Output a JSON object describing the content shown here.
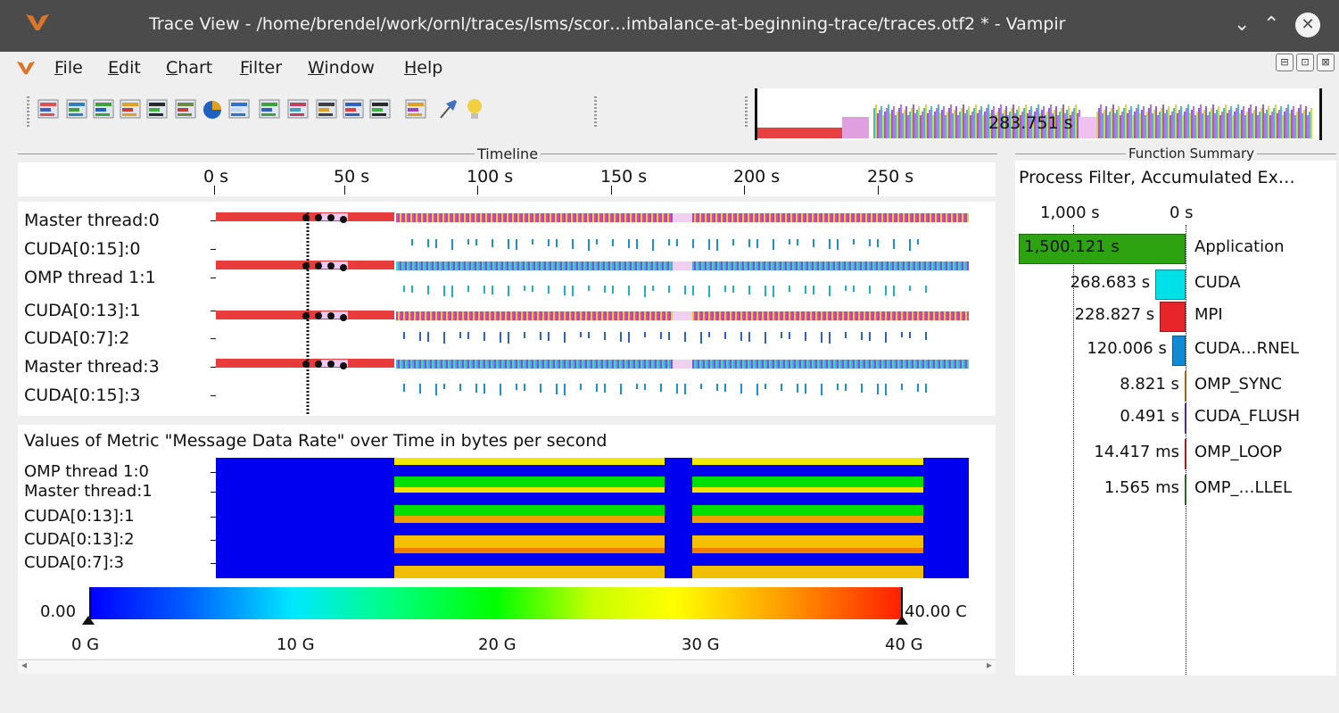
{
  "window": {
    "title": "Trace View - /home/brendel/work/ornl/traces/lsms/scor…imbalance-at-beginning-trace/traces.otf2 * - Vampir",
    "controls": {
      "minimize": "⌄",
      "maximize": "⌃",
      "close": "✕"
    }
  },
  "menu": {
    "items": [
      {
        "label": "File",
        "accel": "F"
      },
      {
        "label": "Edit",
        "accel": "E"
      },
      {
        "label": "Chart",
        "accel": "C"
      },
      {
        "label": "Filter",
        "accel": "F"
      },
      {
        "label": "Window",
        "accel": "W"
      },
      {
        "label": "Help",
        "accel": "H"
      }
    ],
    "mdi_buttons": [
      "⊟",
      "⊡",
      "⊠"
    ]
  },
  "toolbar": {
    "icons": [
      "master-timeline-icon",
      "process-timeline-icon",
      "counter-timeline-icon",
      "performance-radar-icon",
      "summary-timeline-icon",
      "function-summary-icon",
      "pie-chart-icon",
      "context-view-icon",
      "communication-matrix-icon",
      "io-summary-icon",
      "call-tree-icon",
      "function-legend-icon",
      "marker-view-icon",
      "colors-icon",
      "pin-icon",
      "lightbulb-icon"
    ],
    "overview_duration": "283.751 s"
  },
  "timeline": {
    "title": "Timeline",
    "ticks": [
      "0 s",
      "50 s",
      "100 s",
      "150 s",
      "200 s",
      "250 s"
    ],
    "rows": [
      "Master thread:0",
      "CUDA[0:15]:0",
      "OMP thread 1:1",
      "CUDA[0:13]:1",
      "CUDA[0:7]:2",
      "Master thread:3",
      "CUDA[0:15]:3"
    ]
  },
  "metric": {
    "title": "Values of Metric \"Message Data Rate\" over Time in bytes per second",
    "rows": [
      "OMP thread 1:0",
      "Master thread:1",
      "CUDA[0:13]:1",
      "CUDA[0:13]:2",
      "CUDA[0:7]:3"
    ],
    "colorbar": {
      "min_label": "0.00",
      "max_label": "40.00 C",
      "ticks": [
        "0 G",
        "10 G",
        "20 G",
        "30 G",
        "40 G"
      ]
    }
  },
  "function_summary": {
    "title": "Function Summary",
    "subtitle": "Process Filter, Accumulated Ex…",
    "axis": [
      "1,000 s",
      "0 s"
    ],
    "rows": [
      {
        "value": "1,500.121 s",
        "name": "Application",
        "color": "#2ea311",
        "seconds": 1500.121
      },
      {
        "value": "268.683 s",
        "name": "CUDA",
        "color": "#00e0e8",
        "seconds": 268.683
      },
      {
        "value": "228.827 s",
        "name": "MPI",
        "color": "#e8262a",
        "seconds": 228.827
      },
      {
        "value": "120.006 s",
        "name": "CUDA…RNEL",
        "color": "#0f8bd6",
        "seconds": 120.006
      },
      {
        "value": "8.821 s",
        "name": "OMP_SYNC",
        "color": "#e8a020",
        "seconds": 8.821
      },
      {
        "value": "0.491 s",
        "name": "CUDA_FLUSH",
        "color": "#7a40c0",
        "seconds": 0.491
      },
      {
        "value": "14.417 ms",
        "name": "OMP_LOOP",
        "color": "#e83030",
        "seconds": 0.014417
      },
      {
        "value": "1.565 ms",
        "name": "OMP_…LLEL",
        "color": "#40a040",
        "seconds": 0.001565
      }
    ]
  }
}
